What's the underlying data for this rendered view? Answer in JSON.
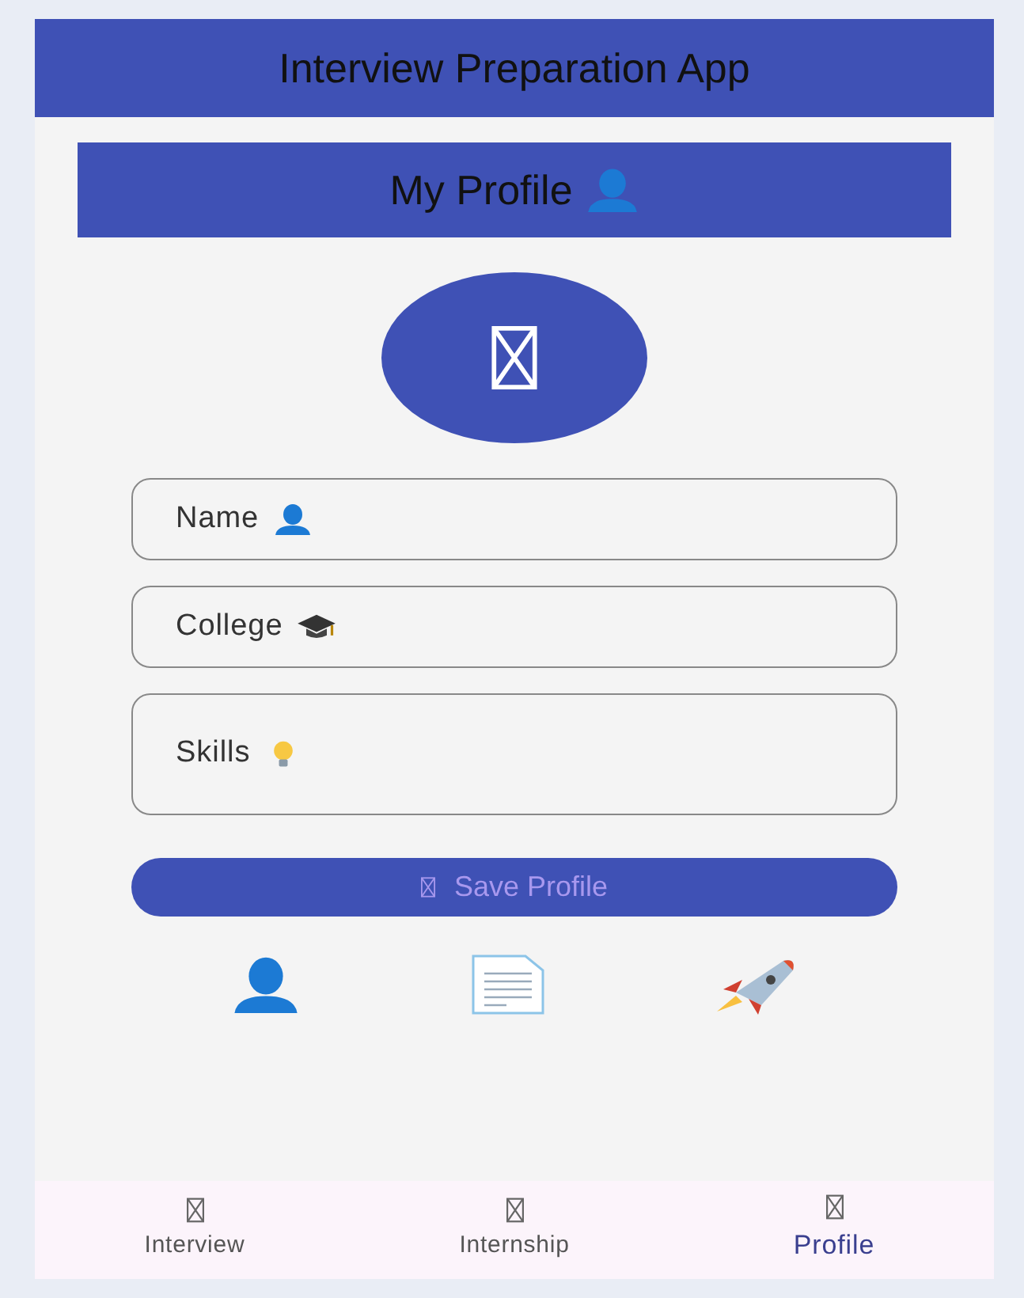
{
  "app_bar": {
    "title": "Interview Preparation App"
  },
  "profile_header": {
    "title": "My Profile"
  },
  "fields": [
    {
      "placeholder": "Name",
      "kind": "person",
      "multiline": false
    },
    {
      "placeholder": "College",
      "kind": "cap",
      "multiline": false
    },
    {
      "placeholder": "Skills",
      "kind": "bulb",
      "multiline": true
    }
  ],
  "save_button": {
    "label": "Save Profile"
  },
  "nav": [
    {
      "label": "Interview",
      "selected": false
    },
    {
      "label": "Internship",
      "selected": false
    },
    {
      "label": "Profile",
      "selected": true
    }
  ]
}
